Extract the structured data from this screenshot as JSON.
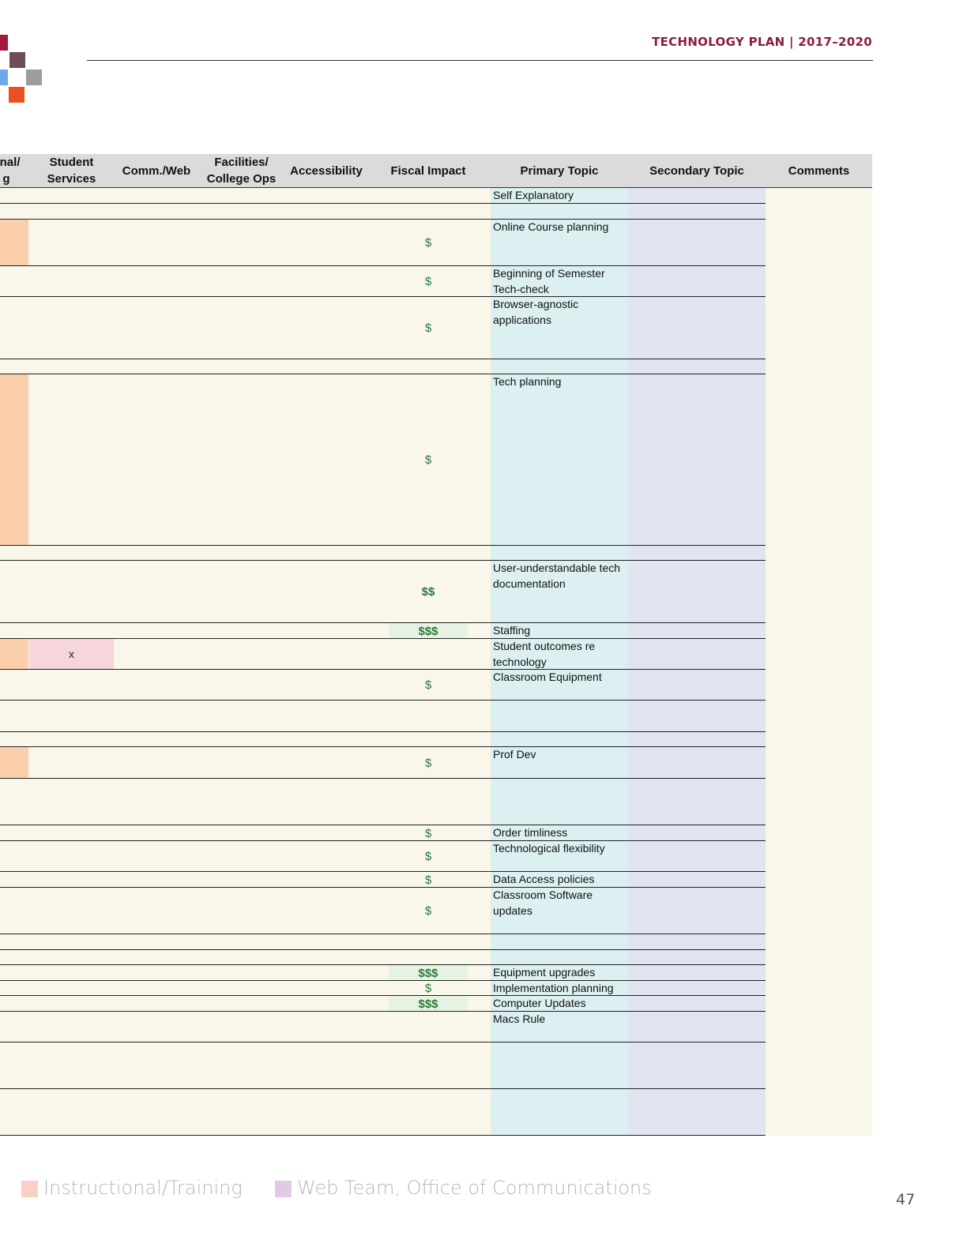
{
  "header": {
    "title": "TECHNOLOGY PLAN | 2017–2020",
    "title_color": "#8c1d40"
  },
  "logo": {
    "colors": [
      "#a2193d",
      "#6e4e55",
      "#6fa8e6",
      "#9d9d9d",
      "#ec4f20"
    ]
  },
  "table": {
    "columns": [
      {
        "label": "onal/\ng"
      },
      {
        "label": "Student\nServices"
      },
      {
        "label": "Comm./Web"
      },
      {
        "label": "Facilities/\nCollege Ops"
      },
      {
        "label": "Accessibility"
      },
      {
        "label": "Fiscal Impact"
      },
      {
        "label": "Primary Topic"
      },
      {
        "label": "Secondary Topic"
      },
      {
        "label": "Comments"
      }
    ],
    "rows": [
      {
        "fiscal": "",
        "primary_topic": "Self Explanatory"
      },
      {
        "fiscal": "",
        "primary_topic": ""
      },
      {
        "fiscal": "$",
        "primary_topic": "Online Course planning"
      },
      {
        "fiscal": "$",
        "primary_topic": "Beginning of Semester Tech-check"
      },
      {
        "fiscal": "$",
        "primary_topic": "Browser-agnostic applications"
      },
      {
        "fiscal": "",
        "primary_topic": ""
      },
      {
        "fiscal": "$",
        "primary_topic": "Tech planning"
      },
      {
        "fiscal": "",
        "primary_topic": ""
      },
      {
        "fiscal": "$$",
        "primary_topic": "User-understandable tech documentation"
      },
      {
        "fiscal": "$$$",
        "primary_topic": "Staffing"
      },
      {
        "fiscal": "",
        "primary_topic": "Student outcomes re technology",
        "student_services": "x"
      },
      {
        "fiscal": "$",
        "primary_topic": "Classroom Equipment"
      },
      {
        "fiscal": "",
        "primary_topic": ""
      },
      {
        "fiscal": "",
        "primary_topic": ""
      },
      {
        "fiscal": "$",
        "primary_topic": "Prof Dev"
      },
      {
        "fiscal": "",
        "primary_topic": ""
      },
      {
        "fiscal": "$",
        "primary_topic": "Order timliness"
      },
      {
        "fiscal": "$",
        "primary_topic": "Technological flexibility"
      },
      {
        "fiscal": "$",
        "primary_topic": "Data Access policies"
      },
      {
        "fiscal": "$",
        "primary_topic": "Classroom Software updates"
      },
      {
        "fiscal": "",
        "primary_topic": ""
      },
      {
        "fiscal": "",
        "primary_topic": ""
      },
      {
        "fiscal": "$$$",
        "primary_topic": "Equipment upgrades"
      },
      {
        "fiscal": "$",
        "primary_topic": "Implementation planning"
      },
      {
        "fiscal": "$$$",
        "primary_topic": "Computer Updates"
      },
      {
        "fiscal": "",
        "primary_topic": "Macs Rule"
      },
      {
        "fiscal": "",
        "primary_topic": ""
      },
      {
        "fiscal": "",
        "primary_topic": ""
      }
    ]
  },
  "legend": [
    {
      "label": "Instructional/Training",
      "color": "#fbcfc6"
    },
    {
      "label": "Web Team, Office of Communications",
      "color": "#e2c9e6"
    }
  ],
  "page_number": "47"
}
